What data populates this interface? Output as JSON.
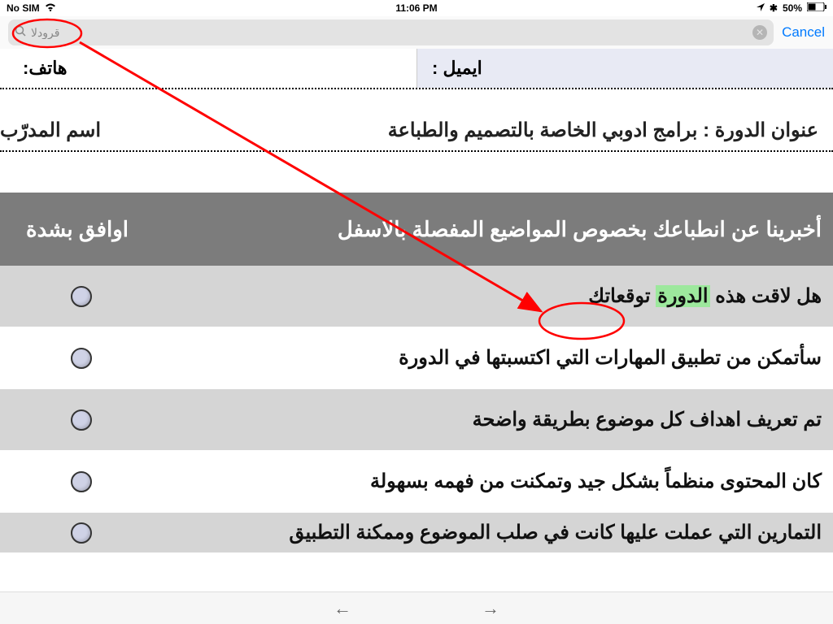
{
  "status": {
    "carrier": "No SIM",
    "time": "11:06 PM",
    "battery": "50%"
  },
  "search": {
    "value": "قرودلا",
    "cancel": "Cancel"
  },
  "contact": {
    "email_label": "ايميل :",
    "phone_label": "هاتف:"
  },
  "course": {
    "title": "عنوان الدورة : برامج ادوبي الخاصة بالتصميم والطباعة",
    "trainer_label": "اسم المدرّب"
  },
  "survey": {
    "header_prompt": "أخبرينا عن انطباعك بخصوص المواضيع المفصلة بالاسفل",
    "col_agree_strong": "اوافق بشدة",
    "rows": [
      {
        "pre": "هل لاقت هذه ",
        "hl": "الدورة",
        "post": " توقعاتك",
        "text": "هل لاقت هذه الدورة توقعاتك"
      },
      {
        "text": "سأتمكن من تطبيق المهارات التي اكتسبتها في الدورة"
      },
      {
        "text": "تم تعريف اهداف كل موضوع بطريقة واضحة"
      },
      {
        "text": "كان المحتوى منظماً بشكل جيد وتمكنت من فهمه بسهولة"
      },
      {
        "text": "التمارين التي عملت عليها كانت في صلب الموضوع وممكنة التطبيق"
      }
    ]
  },
  "annotation": {
    "arrow_color": "#ff0000"
  }
}
